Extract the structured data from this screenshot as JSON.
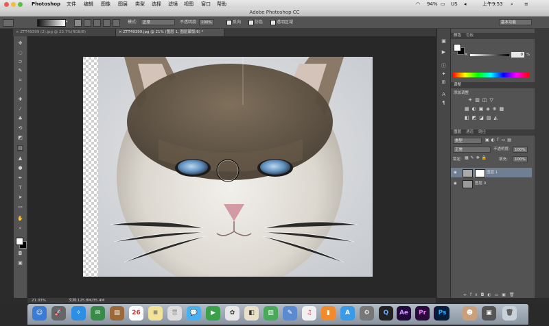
{
  "menubar": {
    "app_name": "Photoshop",
    "menus": [
      "文件",
      "编辑",
      "图像",
      "图层",
      "类型",
      "选择",
      "滤镜",
      "视图",
      "窗口",
      "帮助"
    ],
    "battery": "94%",
    "input_source": "US",
    "clock": "上午9:53"
  },
  "window": {
    "title": "Adobe Photoshop CC"
  },
  "options": {
    "mode_label": "模式:",
    "mode_value": "正常",
    "opacity_label": "不透明度:",
    "opacity_value": "100%",
    "reverse_label": "反向",
    "dither_label": "仿色",
    "transparency_label": "透明区域",
    "workspace": "基本功能"
  },
  "tabs": [
    {
      "label": "ZTT49399 (2).jpg @ 23.7%(RGB/8)",
      "active": false
    },
    {
      "label": "ZTT49399.jpg @ 21% (图层 1, 图层蒙版/8) *",
      "active": true
    }
  ],
  "panels": {
    "color": {
      "tab_color": "颜色",
      "tab_swatches": "色板",
      "k_label": "K",
      "k_value": "0",
      "k_unit": "%"
    },
    "adjustments": {
      "tab": "调整",
      "title": "添加调整"
    },
    "layers": {
      "tab_layers": "图层",
      "tab_channels": "通道",
      "tab_paths": "路径",
      "filter_kind": "类型",
      "blend_mode": "正常",
      "opacity_label": "不透明度:",
      "opacity_value": "100%",
      "lock_label": "锁定:",
      "fill_label": "填充:",
      "fill_value": "100%",
      "items": [
        {
          "name": "图层 1",
          "selected": true
        },
        {
          "name": "图层 0",
          "selected": false
        }
      ]
    }
  },
  "status": {
    "zoom": "21.03%",
    "doc": "文档:125.8M/35.4M"
  },
  "dock": {
    "calendar_day": "26",
    "ae": "Ae",
    "pr1": "Pr",
    "pr2": "Pr",
    "ps": "Ps"
  },
  "colors": {
    "accent_ps": "#31a8ff",
    "accent_pr": "#ea77ff",
    "accent_ae": "#d291ff"
  }
}
